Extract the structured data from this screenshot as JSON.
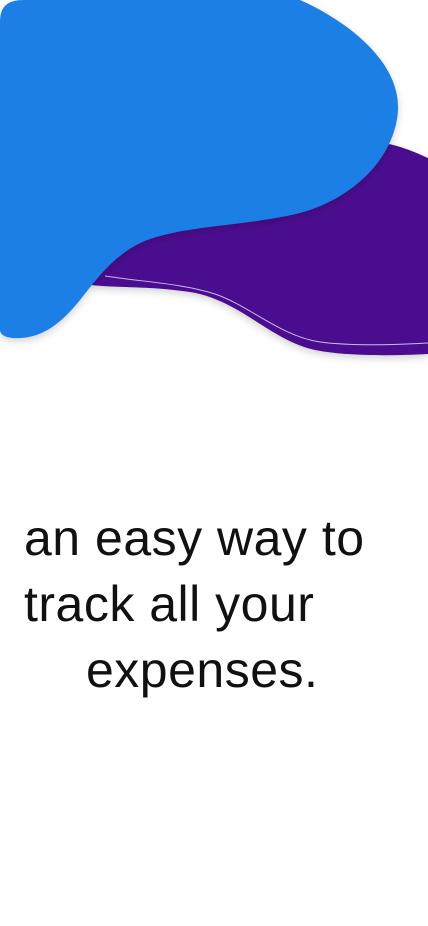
{
  "onboarding": {
    "tagline": {
      "line1": "an easy way to",
      "line2": "track all your",
      "line3": "expenses."
    }
  },
  "colors": {
    "background": "#ffffff",
    "blob_blue": "#1a7fe6",
    "blob_purple": "#4b0b8f",
    "text": "#111111"
  }
}
